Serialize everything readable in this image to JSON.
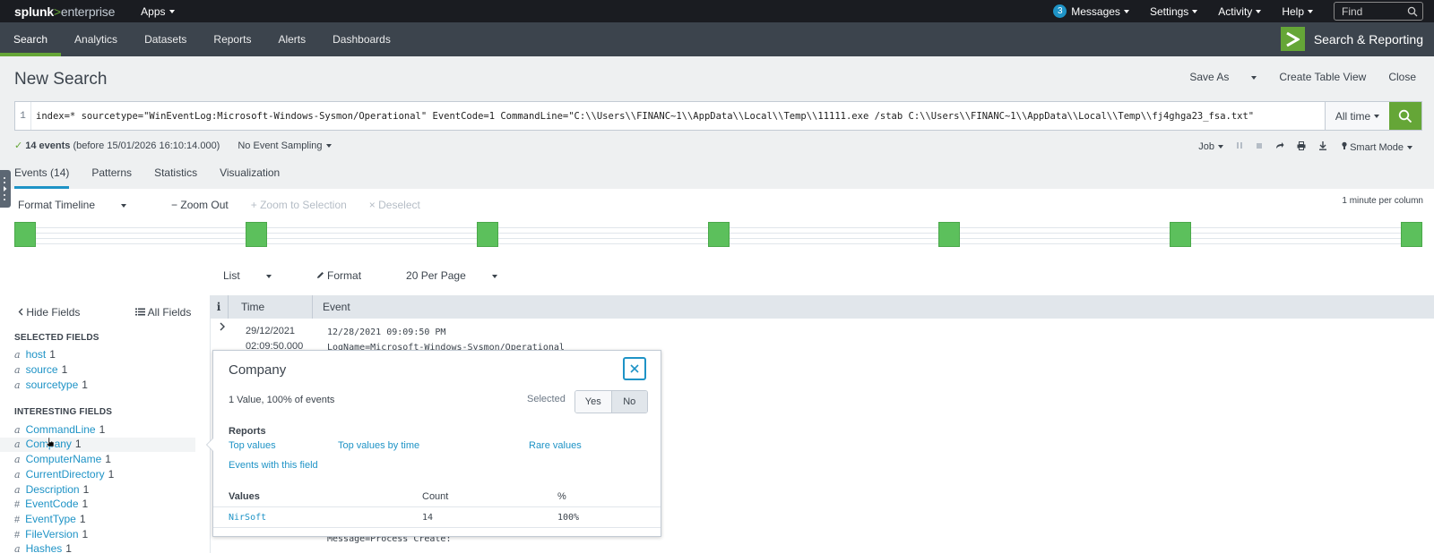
{
  "topbar": {
    "logo_brand": "splunk",
    "logo_gt": ">",
    "logo_product": "enterprise",
    "apps": "Apps",
    "messages_count": "3",
    "messages": "Messages",
    "settings": "Settings",
    "activity": "Activity",
    "help": "Help",
    "find_placeholder": "Find"
  },
  "appnav": {
    "tabs": [
      "Search",
      "Analytics",
      "Datasets",
      "Reports",
      "Alerts",
      "Dashboards"
    ],
    "app_name": "Search & Reporting"
  },
  "page": {
    "title": "New Search",
    "save_as": "Save As",
    "create_table_view": "Create Table View",
    "close": "Close"
  },
  "search": {
    "line_number": "1",
    "query": "index=* sourcetype=\"WinEventLog:Microsoft-Windows-Sysmon/Operational\" EventCode=1 CommandLine=\"C:\\\\Users\\\\FINANC~1\\\\AppData\\\\Local\\\\Temp\\\\11111.exe /stab C:\\\\Users\\\\FINANC~1\\\\AppData\\\\Local\\\\Temp\\\\fj4ghga23_fsa.txt\"",
    "time_range": "All time"
  },
  "status": {
    "check": "✓",
    "events": "14 events",
    "before": "(before 15/01/2026 16:10:14.000)",
    "sampling": "No Event Sampling",
    "job": "Job",
    "mode": "Smart Mode"
  },
  "result_tabs": [
    "Events (14)",
    "Patterns",
    "Statistics",
    "Visualization"
  ],
  "timeline": {
    "format": "Format Timeline",
    "zoom_out": "− Zoom Out",
    "zoom_selection": "+ Zoom to Selection",
    "deselect": "× Deselect",
    "scale": "1 minute per column",
    "bars": 7
  },
  "list_controls": {
    "list": "List",
    "format": "Format",
    "per_page": "20 Per Page"
  },
  "fields": {
    "hide": "Hide Fields",
    "all": "All Fields",
    "selected_title": "SELECTED FIELDS",
    "interesting_title": "INTERESTING FIELDS",
    "selected": [
      {
        "type": "a",
        "name": "host",
        "count": "1"
      },
      {
        "type": "a",
        "name": "source",
        "count": "1"
      },
      {
        "type": "a",
        "name": "sourcetype",
        "count": "1"
      }
    ],
    "interesting": [
      {
        "type": "a",
        "name": "CommandLine",
        "count": "1"
      },
      {
        "type": "a",
        "name": "Company",
        "count": "1"
      },
      {
        "type": "a",
        "name": "ComputerName",
        "count": "1"
      },
      {
        "type": "a",
        "name": "CurrentDirectory",
        "count": "1"
      },
      {
        "type": "a",
        "name": "Description",
        "count": "1"
      },
      {
        "type": "#",
        "name": "EventCode",
        "count": "1"
      },
      {
        "type": "#",
        "name": "EventType",
        "count": "1"
      },
      {
        "type": "#",
        "name": "FileVersion",
        "count": "1"
      },
      {
        "type": "a",
        "name": "Hashes",
        "count": "1"
      }
    ]
  },
  "events": {
    "col_info": "i",
    "col_time": "Time",
    "col_event": "Event",
    "row1_date": "29/12/2021",
    "row1_time": "02:09:50.000",
    "row1_line1": "12/28/2021 09:09:50 PM",
    "row1_line2": "LogName=Microsoft-Windows-Sysmon/Operational",
    "row1_line_bottom": "Message=Process Create:"
  },
  "popover": {
    "title": "Company",
    "summary": "1 Value, 100% of events",
    "selected_label": "Selected",
    "yes": "Yes",
    "no": "No",
    "reports_title": "Reports",
    "top_values": "Top values",
    "top_values_time": "Top values by time",
    "rare_values": "Rare values",
    "events_with_field": "Events with this field",
    "col_values": "Values",
    "col_count": "Count",
    "col_pct": "%",
    "row_value": "NirSoft",
    "row_count": "14",
    "row_pct": "100%"
  },
  "colors": {
    "topbar_bg": "#1a1c21",
    "nav_bg": "#3c444d",
    "accent_green": "#65a637",
    "link_blue": "#1e93c6",
    "timeline_green": "#5cc05c"
  }
}
